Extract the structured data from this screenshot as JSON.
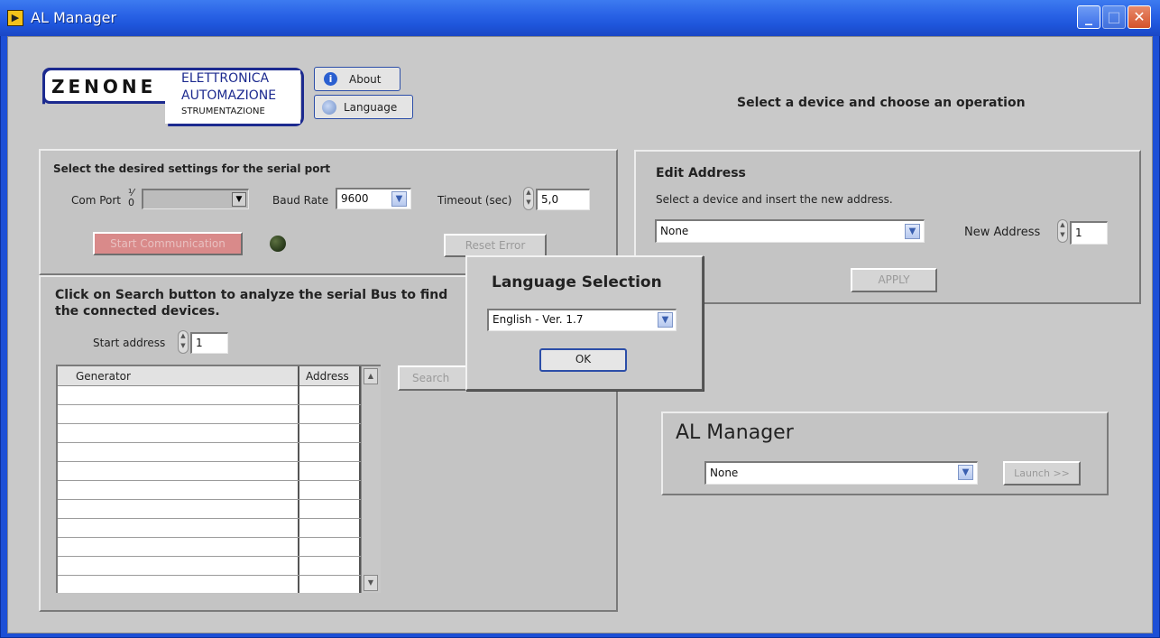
{
  "window": {
    "title": "AL Manager"
  },
  "logo": {
    "brand": "ZENONE",
    "line1": "ELETTRONICA",
    "line2": "AUTOMAZIONE",
    "line3": "STRUMENTAZIONE"
  },
  "buttons": {
    "about": "About",
    "language": "Language"
  },
  "header": {
    "instruction": "Select a device and choose an operation"
  },
  "serial": {
    "title": "Select the desired settings for the serial port",
    "com_port_label": "Com Port",
    "com_port_value": "",
    "baud_label": "Baud Rate",
    "baud_value": "9600",
    "timeout_label": "Timeout (sec)",
    "timeout_value": "5,0",
    "start_button": "Start Communication",
    "reset_button": "Reset Error"
  },
  "search": {
    "title_line1": "Click on Search button to analyze the serial Bus to find",
    "title_line2": "the connected devices.",
    "start_address_label": "Start address",
    "start_address_value": "1",
    "columns": [
      "Generator",
      "Address"
    ],
    "search_button": "Search"
  },
  "edit_address": {
    "title": "Edit Address",
    "subtitle": "Select a device and insert the new address.",
    "device_value": "None",
    "new_address_label": "New Address",
    "new_address_value": "1",
    "apply_button": "APPLY"
  },
  "al_manager": {
    "title": "AL Manager",
    "device_value": "None",
    "launch_button": "Launch >>"
  },
  "language_dialog": {
    "title": "Language Selection",
    "selected": "English - Ver. 1.7",
    "ok_button": "OK"
  },
  "colors": {
    "titlebar": "#2a63e6",
    "panel": "#c4c4c4",
    "led": "#2d3f1e",
    "start_button": "#d98a8a"
  }
}
